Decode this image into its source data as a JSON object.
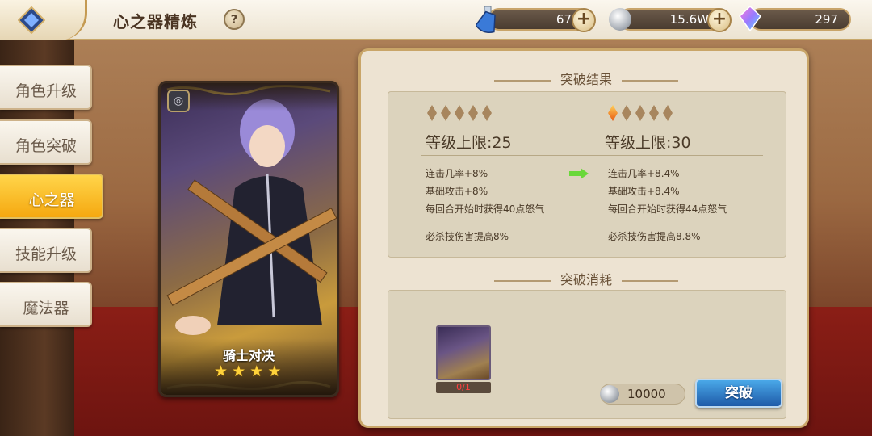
{
  "header": {
    "title": "心之器精炼",
    "help_label": "?"
  },
  "currencies": [
    {
      "icon": "blue-potion-icon",
      "value": "67"
    },
    {
      "icon": "silver-coin-icon",
      "value": "15.6W"
    },
    {
      "icon": "rainbow-crystal-icon",
      "value": "297"
    }
  ],
  "sidebar": {
    "items": [
      {
        "label": "角色升级",
        "active": false
      },
      {
        "label": "角色突破",
        "active": false
      },
      {
        "label": "心之器",
        "active": true
      },
      {
        "label": "技能升级",
        "active": false
      },
      {
        "label": "魔法器",
        "active": false
      }
    ]
  },
  "card": {
    "name": "骑士对决",
    "stars": 4,
    "star_glyph": "★"
  },
  "result": {
    "title": "突破结果",
    "current": {
      "tier_filled": 0,
      "level_label": "等级上限:25",
      "stats": [
        "连击几率+8%",
        "基础攻击+8%",
        "每回合开始时获得40点怒气",
        "必杀技伤害提高8%"
      ]
    },
    "next": {
      "tier_filled": 1,
      "level_label": "等级上限:30",
      "stats": [
        "连击几率+8.4%",
        "基础攻击+8.4%",
        "每回合开始时获得44点怒气",
        "必杀技伤害提高8.8%"
      ]
    }
  },
  "cost": {
    "title": "突破消耗",
    "item_count": "0/1",
    "coin_cost": "10000",
    "break_label": "突破"
  },
  "colors": {
    "active_tab": "#f5a810",
    "break_button": "#1e5aa8",
    "panel_bg": "#ede3d2"
  }
}
